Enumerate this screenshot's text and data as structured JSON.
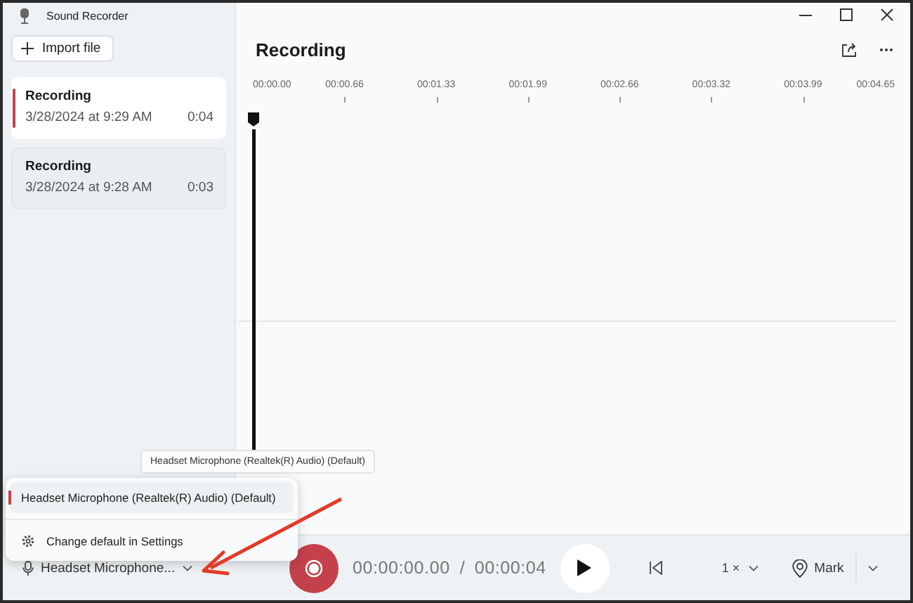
{
  "window": {
    "title": "Sound Recorder"
  },
  "sidebar": {
    "import_button": "Import file",
    "recordings": [
      {
        "title": "Recording",
        "date": "3/28/2024 at 9:29 AM",
        "duration": "0:04",
        "selected": true
      },
      {
        "title": "Recording",
        "date": "3/28/2024 at 9:28 AM",
        "duration": "0:03",
        "selected": false
      }
    ]
  },
  "main": {
    "title": "Recording",
    "timeline_labels": [
      "00:00.00",
      "00:00.66",
      "00:01.33",
      "00:01.99",
      "00:02.66",
      "00:03.32",
      "00:03.99",
      "00:04.65"
    ]
  },
  "tooltip": "Headset Microphone (Realtek(R) Audio) (Default)",
  "microphone_menu": {
    "items": [
      {
        "kind": "device",
        "label": "Headset Microphone (Realtek(R) Audio) (Default)",
        "selected": true
      },
      {
        "kind": "settings",
        "label": "Change default in Settings",
        "selected": false
      }
    ]
  },
  "bottom_bar": {
    "microphone": "Headset Microphone...",
    "elapsed": "00:00:00.00",
    "separator": "/",
    "total": "00:00:04",
    "speed": "1 ×",
    "mark": "Mark"
  }
}
